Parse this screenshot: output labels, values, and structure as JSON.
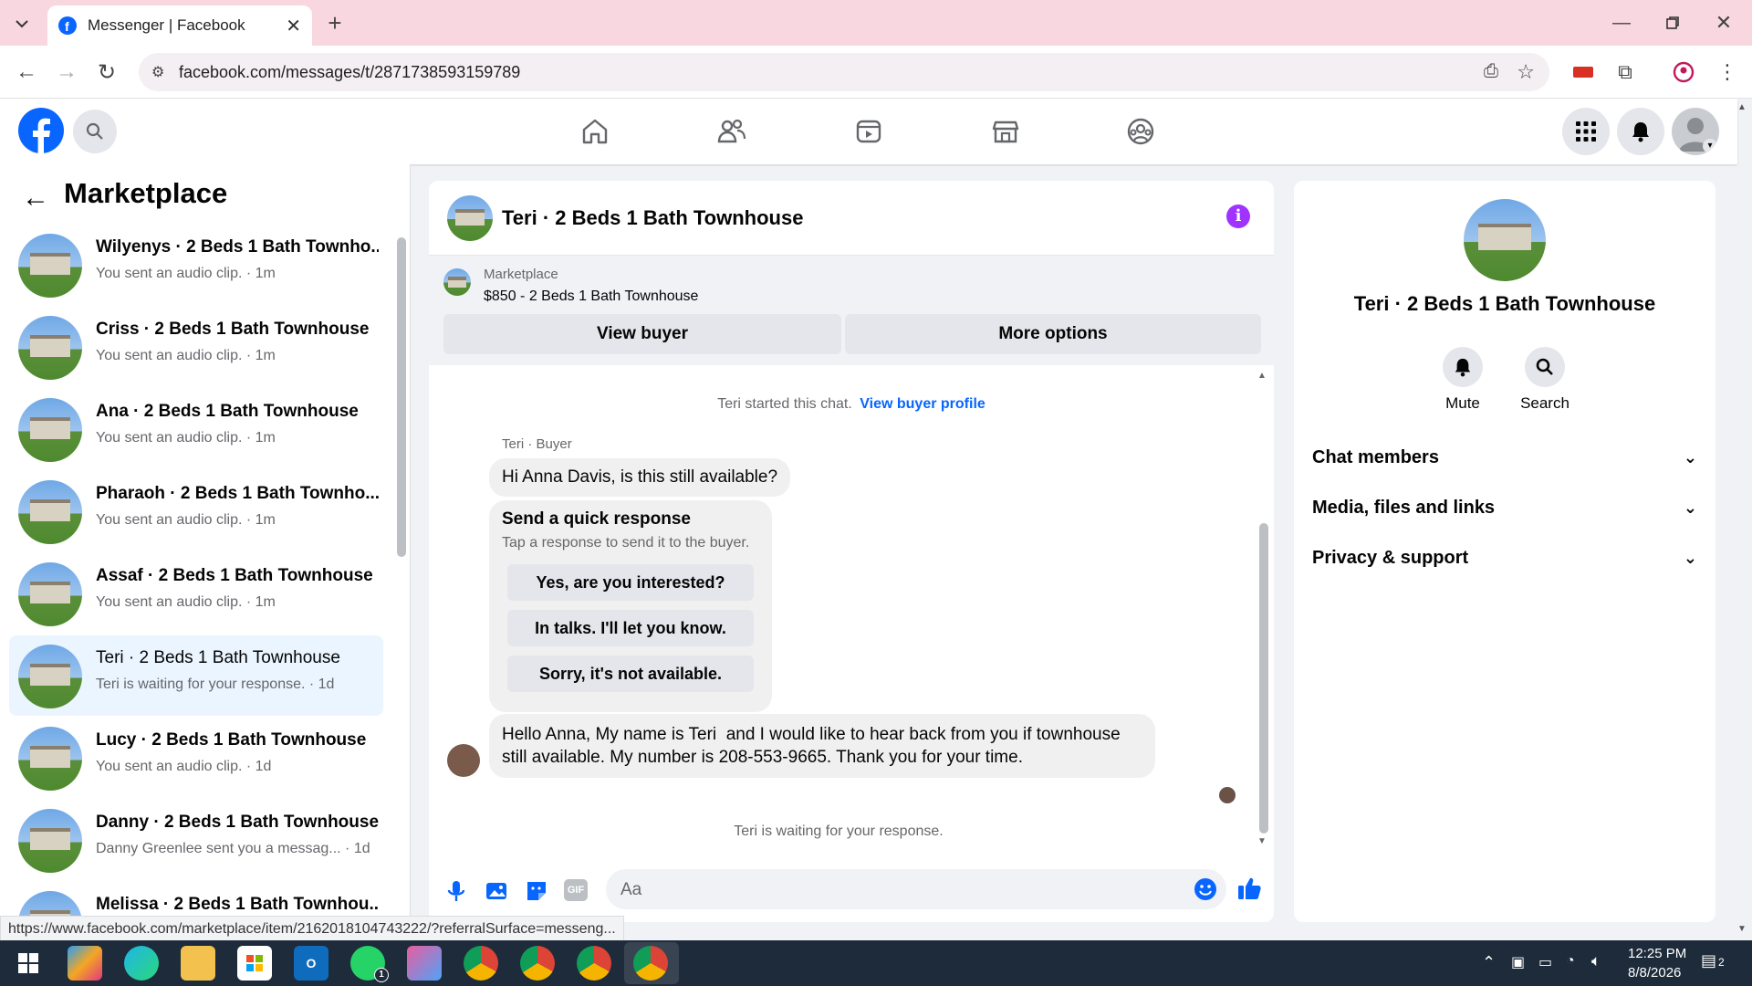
{
  "browser": {
    "tab_title": "Messenger | Facebook",
    "url": "facebook.com/messages/t/2871738593159789",
    "status_url": "https://www.facebook.com/marketplace/item/2162018104743222/?referralSurface=messeng..."
  },
  "sidebar": {
    "title": "Marketplace",
    "conversations": [
      {
        "name": "Wilyenys · 2 Beds 1 Bath Townho...",
        "preview": "You sent an audio clip. · 1m"
      },
      {
        "name": "Criss · 2 Beds 1 Bath Townhouse",
        "preview": "You sent an audio clip. · 1m"
      },
      {
        "name": "Ana · 2 Beds 1 Bath Townhouse",
        "preview": "You sent an audio clip. · 1m"
      },
      {
        "name": "Pharaoh · 2 Beds 1 Bath Townho...",
        "preview": "You sent an audio clip. · 1m"
      },
      {
        "name": "Assaf · 2 Beds 1 Bath Townhouse",
        "preview": "You sent an audio clip. · 1m"
      },
      {
        "name": "Teri · 2 Beds 1 Bath Townhouse",
        "preview": "Teri is waiting for your response. · 1d"
      },
      {
        "name": "Lucy · 2 Beds 1 Bath Townhouse",
        "preview": "You sent an audio clip. · 1d"
      },
      {
        "name": "Danny · 2 Beds 1 Bath Townhouse",
        "preview": "Danny Greenlee sent you a messag... · 1d"
      },
      {
        "name": "Melissa · 2 Beds 1 Bath Townhou...",
        "preview": ""
      }
    ]
  },
  "chat": {
    "title": "Teri · 2 Beds 1 Bath Townhouse",
    "marketplace_label": "Marketplace",
    "listing": "$850 - 2 Beds 1 Bath Townhouse",
    "view_buyer": "View buyer",
    "more_options": "More options",
    "started_note": "Teri started this chat.",
    "view_buyer_profile": "View buyer profile",
    "sender_label": "Teri · Buyer",
    "msg1": "Hi Anna Davis, is this still available?",
    "quick_title": "Send a quick response",
    "quick_sub": "Tap a response to send it to the buyer.",
    "quick_replies": [
      "Yes, are you interested?",
      "In talks. I'll let you know.",
      "Sorry, it's not available."
    ],
    "msg2_line1": "Hello Anna, My name is Teri  and I would like to hear back from you if townhouse",
    "msg2_line2": "still available. My number is 208-553-9665. Thank you for your time.",
    "waiting_note": "Teri is waiting for your response.",
    "composer_placeholder": "Aa"
  },
  "right_panel": {
    "title": "Teri · 2 Beds 1 Bath Townhouse",
    "mute": "Mute",
    "search": "Search",
    "sections": [
      "Chat members",
      "Media, files and links",
      "Privacy & support"
    ]
  },
  "taskbar": {
    "time": "12:25 PM",
    "date": "8/8/2026",
    "notif_count": "2",
    "whatsapp_badge": "1"
  },
  "colors": {
    "fb_blue": "#0866ff",
    "purple_info": "#a033ff",
    "active_item": "#ebf5ff"
  }
}
